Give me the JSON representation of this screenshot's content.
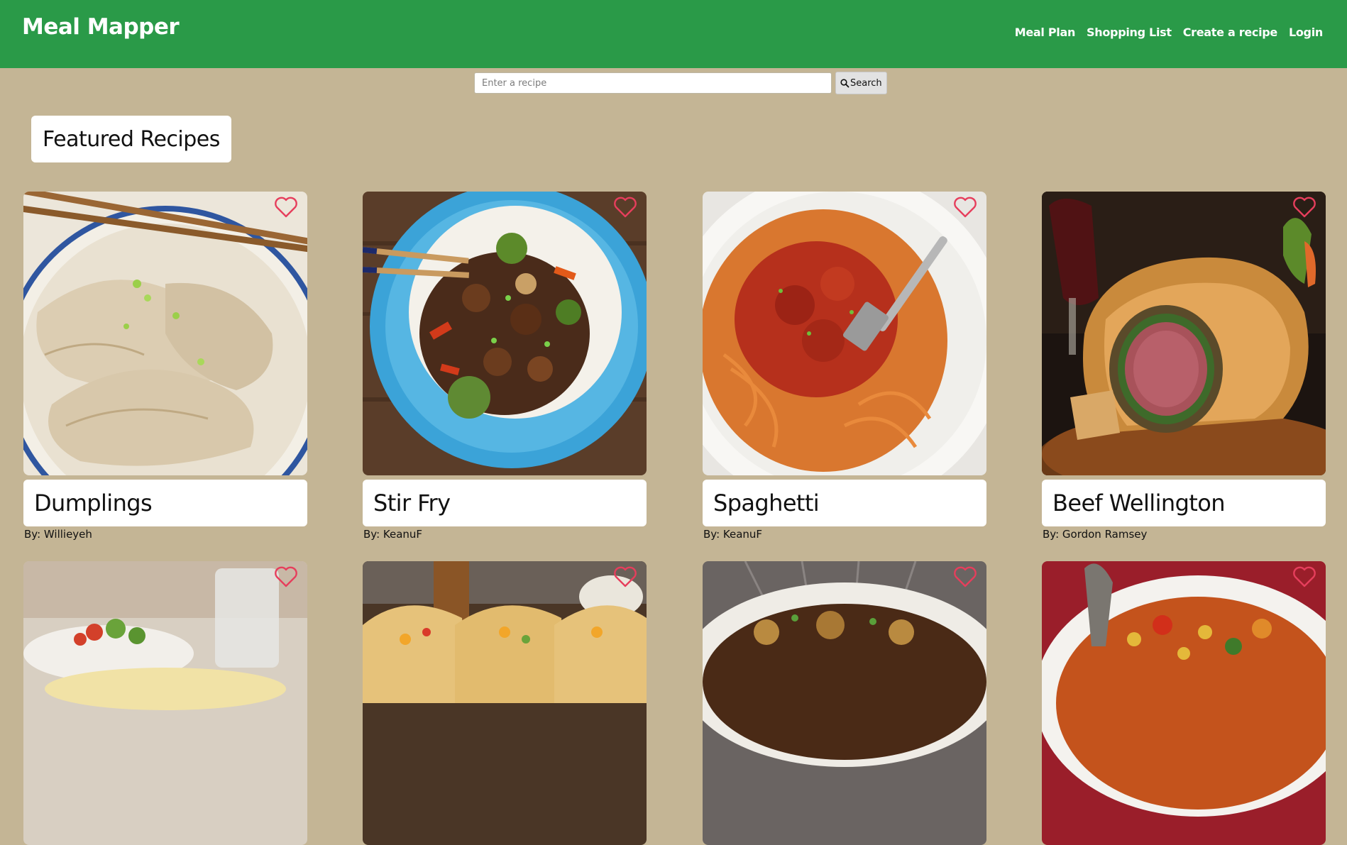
{
  "header": {
    "brand": "Meal Mapper",
    "nav": [
      "Meal Plan",
      "Shopping List",
      "Create a recipe",
      "Login"
    ]
  },
  "search": {
    "placeholder": "Enter a recipe",
    "button_label": "Search"
  },
  "section_title": "Featured Recipes",
  "colors": {
    "navbar": "#2a9a48",
    "page_background": "#c4b595",
    "heart": "#e63e5c"
  },
  "recipes": [
    {
      "title": "Dumplings",
      "author": "By: Willieyeh"
    },
    {
      "title": "Stir Fry",
      "author": "By: KeanuF"
    },
    {
      "title": "Spaghetti",
      "author": "By: KeanuF"
    },
    {
      "title": "Beef Wellington",
      "author": "By: Gordon Ramsey"
    },
    {
      "title": "",
      "author": ""
    },
    {
      "title": "",
      "author": ""
    },
    {
      "title": "",
      "author": ""
    },
    {
      "title": "",
      "author": ""
    }
  ]
}
